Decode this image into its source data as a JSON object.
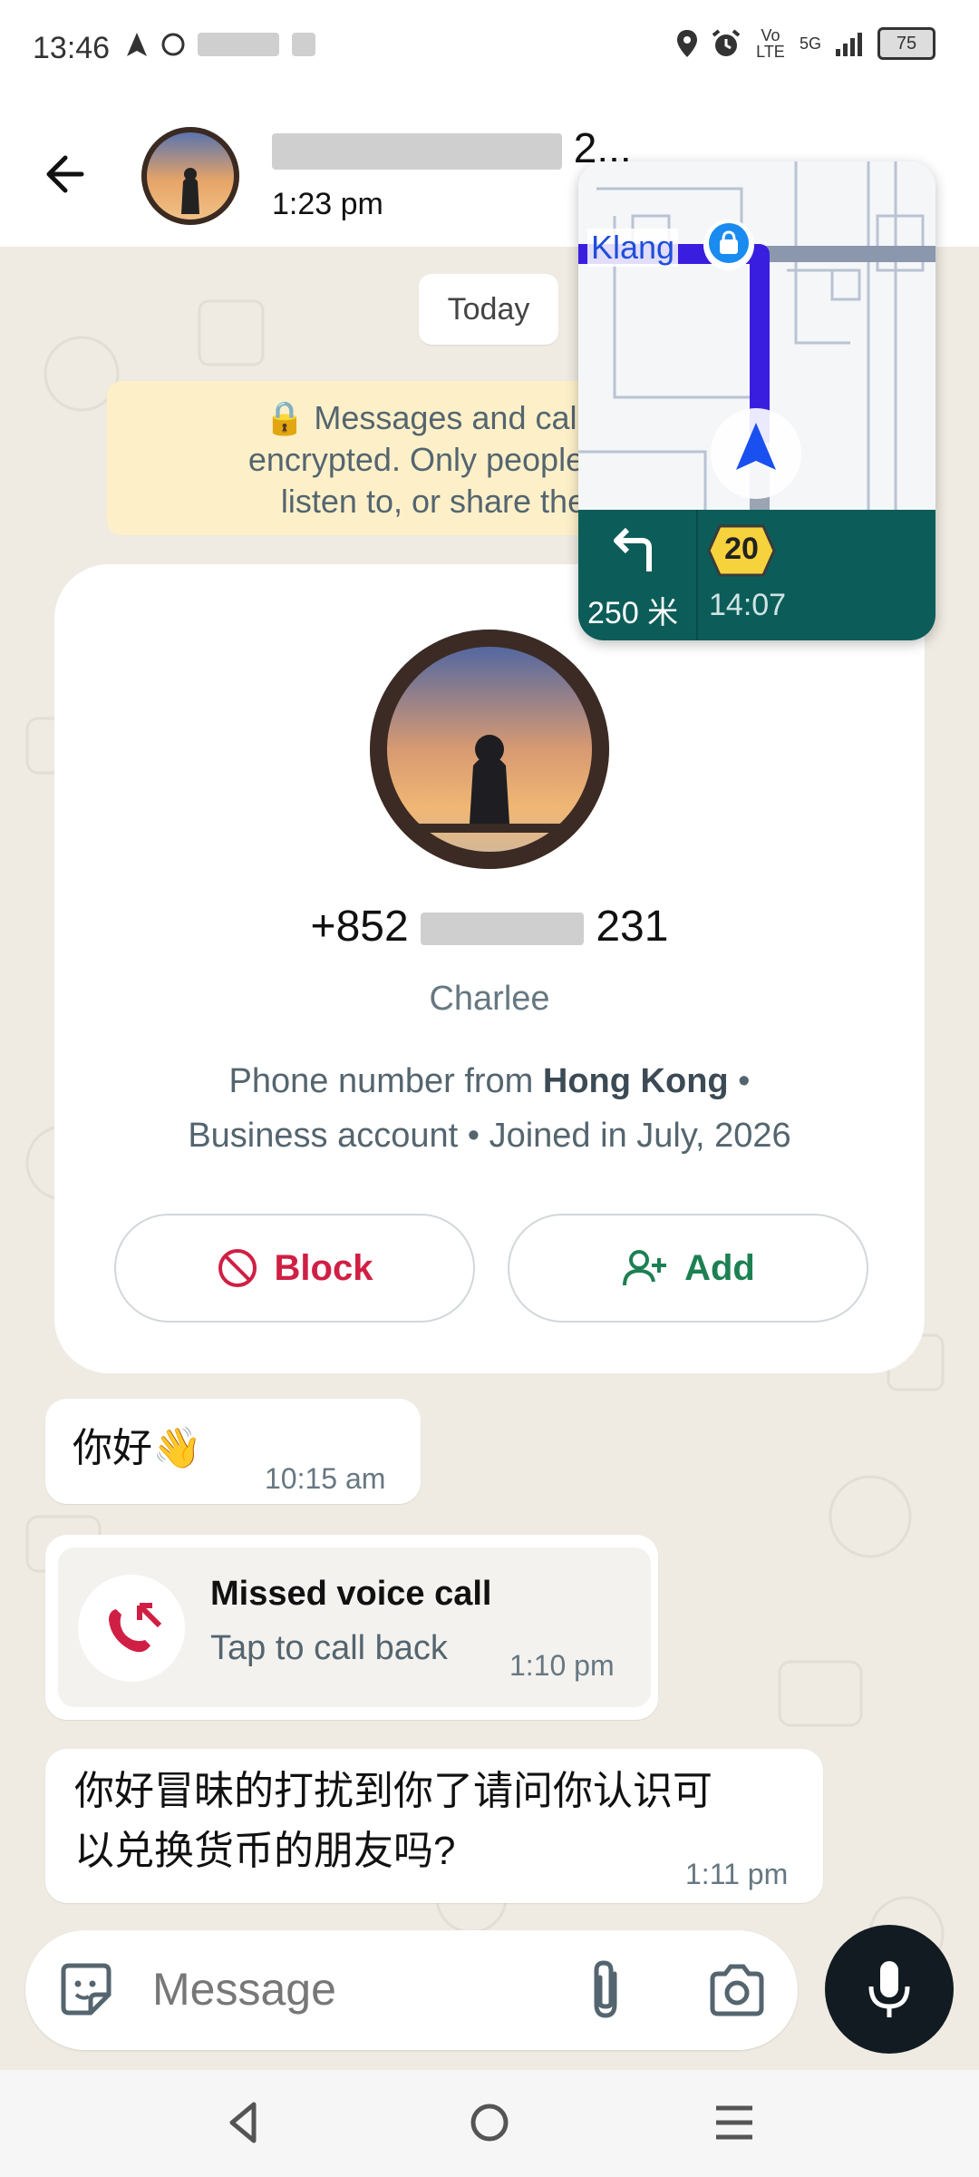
{
  "status_bar": {
    "time": "13:46",
    "battery": "75",
    "signal_label": "5G",
    "volte_label": "Vo LTE"
  },
  "header": {
    "contact_name_visible": "2...",
    "last_seen": "1:23 pm"
  },
  "chat": {
    "date_chip": "Today",
    "encryption_notice": [
      "🔒 Messages and calls ar",
      "encrypted. Only people in th",
      "listen to, or share them."
    ]
  },
  "contact_card": {
    "phone_visible_start": "+852",
    "phone_visible_end": "231",
    "name": "Charlee",
    "info_line1_prefix": "Phone number from ",
    "info_line1_bold": "Hong Kong",
    "info_line1_suffix": " •",
    "info_line2": "Business account • Joined in July, 2026",
    "block_label": "Block",
    "add_label": "Add"
  },
  "messages": [
    {
      "type": "text",
      "text": "你好👋",
      "time": "10:15 am"
    },
    {
      "type": "missed_call",
      "title": "Missed voice call",
      "subtitle": "Tap to call back",
      "time": "1:10 pm"
    },
    {
      "type": "text",
      "line1": "你好冒昧的打扰到你了请问你认识可",
      "line2": "以兑换货币的朋友吗?",
      "time": "1:11 pm"
    }
  ],
  "input": {
    "placeholder": "Message"
  },
  "nav_overlay": {
    "street": "Klang",
    "speed_limit": "20",
    "distance": "250 米",
    "eta": "14:07"
  },
  "colors": {
    "block_red": "#d01f44",
    "add_green": "#1d8052",
    "nav_teal": "#0c5d59",
    "route_blue": "#3a1ee0"
  }
}
